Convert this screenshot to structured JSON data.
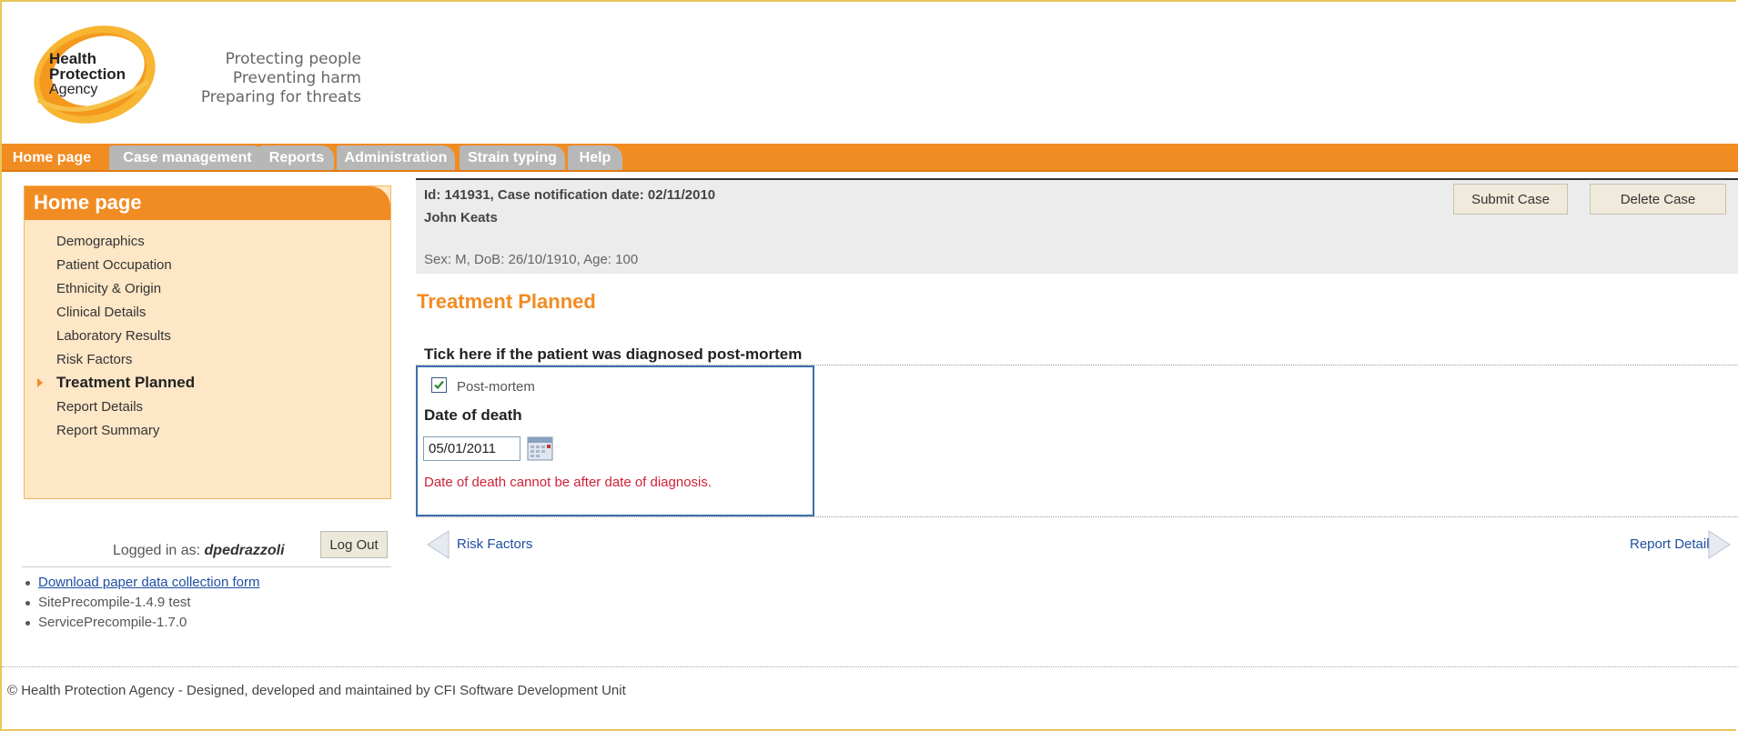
{
  "header": {
    "logo_lines": [
      "Health",
      "Protection",
      "Agency"
    ],
    "tagline": [
      "Protecting people",
      "Preventing harm",
      "Preparing for threats"
    ]
  },
  "nav": {
    "tabs": [
      {
        "label": "Home page",
        "active": true
      },
      {
        "label": "Case management",
        "active": false
      },
      {
        "label": "Reports",
        "active": false
      },
      {
        "label": "Administration",
        "active": false
      },
      {
        "label": "Strain typing",
        "active": false
      },
      {
        "label": "Help",
        "active": false
      }
    ]
  },
  "sidebar": {
    "title": "Home page",
    "items": [
      {
        "label": "Demographics"
      },
      {
        "label": "Patient Occupation"
      },
      {
        "label": "Ethnicity & Origin"
      },
      {
        "label": "Clinical Details"
      },
      {
        "label": "Laboratory Results"
      },
      {
        "label": "Risk Factors"
      },
      {
        "label": "Treatment Planned",
        "active": true
      },
      {
        "label": "Report Details"
      },
      {
        "label": "Report Summary"
      }
    ]
  },
  "login": {
    "label": "Logged in as:",
    "user": "dpedrazzoli",
    "logout_label": "Log Out"
  },
  "links": {
    "download_form": "Download paper data collection form",
    "site_version": "SitePrecompile-1.4.9 test",
    "service_version": "ServicePrecompile-1.7.0"
  },
  "case": {
    "id_line": "Id: 141931, Case notification date: 02/11/2010",
    "name": "John Keats",
    "demographics": "Sex: M, DoB: 26/10/1910, Age: 100",
    "submit_label": "Submit Case",
    "delete_label": "Delete Case"
  },
  "form": {
    "section_title": "Treatment Planned",
    "question": "Tick here if the patient was diagnosed post-mortem",
    "checkbox_label": "Post-mortem",
    "checkbox_checked": true,
    "date_label": "Date of death",
    "date_value": "05/01/2011",
    "error": "Date of death cannot be after date of diagnosis."
  },
  "pager": {
    "prev": "Risk Factors",
    "next": "Report Details"
  },
  "footer": {
    "text": "© Health Protection Agency - Designed, developed and maintained by CFI Software Development Unit"
  },
  "colors": {
    "brand_orange": "#f18c22",
    "error_red": "#d0223a",
    "link_blue": "#1f4ea3"
  }
}
